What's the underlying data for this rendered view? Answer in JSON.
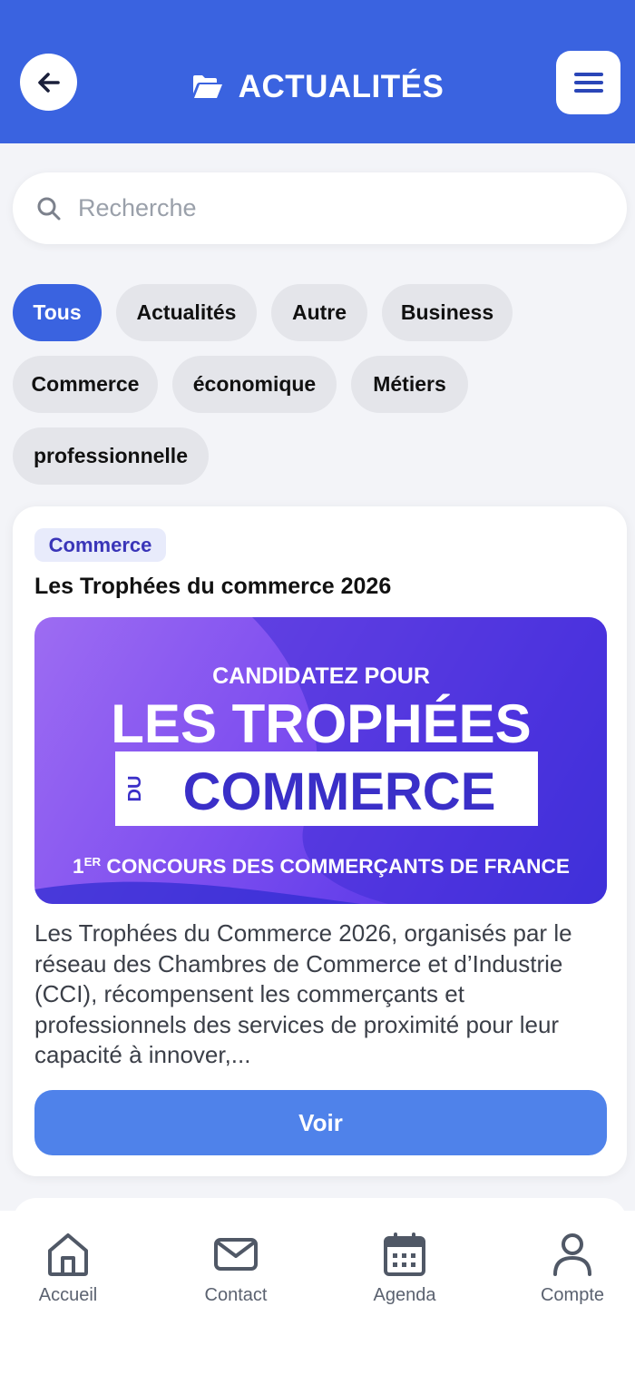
{
  "header": {
    "title": "ACTUALITÉS",
    "back_icon": "arrow-left-icon",
    "folder_icon": "folder-open-icon",
    "menu_icon": "hamburger-menu-icon",
    "color": "#3a63e0"
  },
  "search": {
    "placeholder": "Recherche",
    "icon": "search-icon"
  },
  "filters": {
    "items": [
      "Tous",
      "Actualités",
      "Autre",
      "Business",
      "Commerce",
      "économique",
      "Métiers",
      "professionnelle"
    ],
    "active": "Tous"
  },
  "article": {
    "tag": "Commerce",
    "title": "Les Trophées du commerce 2026",
    "banner": {
      "line1": "CANDIDATEZ POUR",
      "line2": "LES TROPHÉES",
      "line3_small": "DU",
      "line3": "COMMERCE",
      "line4_prefix": "1",
      "line4_sup": "ER",
      "line4": "CONCOURS DES COMMERÇANTS DE FRANCE"
    },
    "description": "Les Trophées du Commerce 2026, organisés par le réseau des Chambres de Commerce et d’Industrie (CCI), récompensent les commerçants et professionnels des services de proximité pour leur capacité à innover,...",
    "button": "Voir"
  },
  "tabbar": {
    "items": [
      {
        "label": "Accueil",
        "icon": "home-icon"
      },
      {
        "label": "Contact",
        "icon": "mail-icon"
      },
      {
        "label": "Agenda",
        "icon": "calendar-icon"
      },
      {
        "label": "Compte",
        "icon": "user-icon"
      }
    ]
  }
}
